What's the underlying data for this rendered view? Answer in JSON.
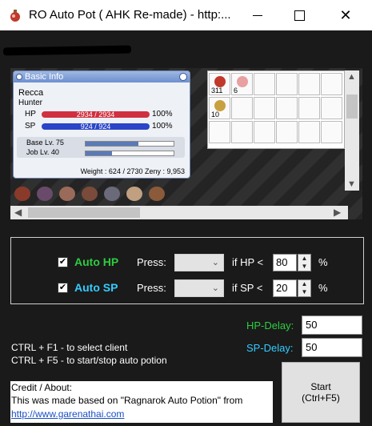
{
  "window": {
    "title": "RO Auto Pot ( AHK Re-made) - http:..."
  },
  "preview": {
    "basic_info": {
      "header": "Basic Info",
      "name": "Recca",
      "class": "Hunter",
      "hp_label": "HP",
      "hp_value": "2934 / 2934",
      "hp_pct": "100%",
      "hp_fill": 1.0,
      "sp_label": "SP",
      "sp_value": "924 / 924",
      "sp_pct": "100%",
      "sp_fill": 1.0,
      "base_lv": "Base Lv. 75",
      "base_exp_fill": 0.6,
      "job_lv": "Job Lv. 40",
      "job_exp_fill": 0.3,
      "footer": "Weight : 624 / 2730  Zeny : 9,953"
    },
    "inventory": {
      "slots": [
        {
          "qty": "311",
          "item_color": "#c0392b"
        },
        {
          "qty": "6",
          "item_color": "#e8a0a0"
        },
        {
          "qty": "10",
          "item_color": "#c9a040"
        }
      ]
    }
  },
  "auto_hp": {
    "label": "Auto HP",
    "checked": true,
    "color": "#2ecc40",
    "press_label": "Press:",
    "key": "",
    "if_label": "if HP <",
    "threshold": "80",
    "unit": "%"
  },
  "auto_sp": {
    "label": "Auto SP",
    "checked": true,
    "color": "#33ccff",
    "press_label": "Press:",
    "key": "",
    "if_label": "if SP <",
    "threshold": "20",
    "unit": "%"
  },
  "delays": {
    "hp_label": "HP-Delay:",
    "hp_value": "50",
    "hp_color": "#2ecc40",
    "sp_label": "SP-Delay:",
    "sp_value": "50",
    "sp_color": "#33ccff"
  },
  "hints": {
    "line1": "CTRL + F1 - to select client",
    "line2": "CTRL + F5 - to start/stop auto potion"
  },
  "credit": {
    "line1": "Credit / About:",
    "line2": "This was made based on \"Ragnarok Auto Potion\" from",
    "link": "http://www.garenathai.com"
  },
  "start_button": {
    "line1": "Start",
    "line2": "(Ctrl+F5)"
  }
}
